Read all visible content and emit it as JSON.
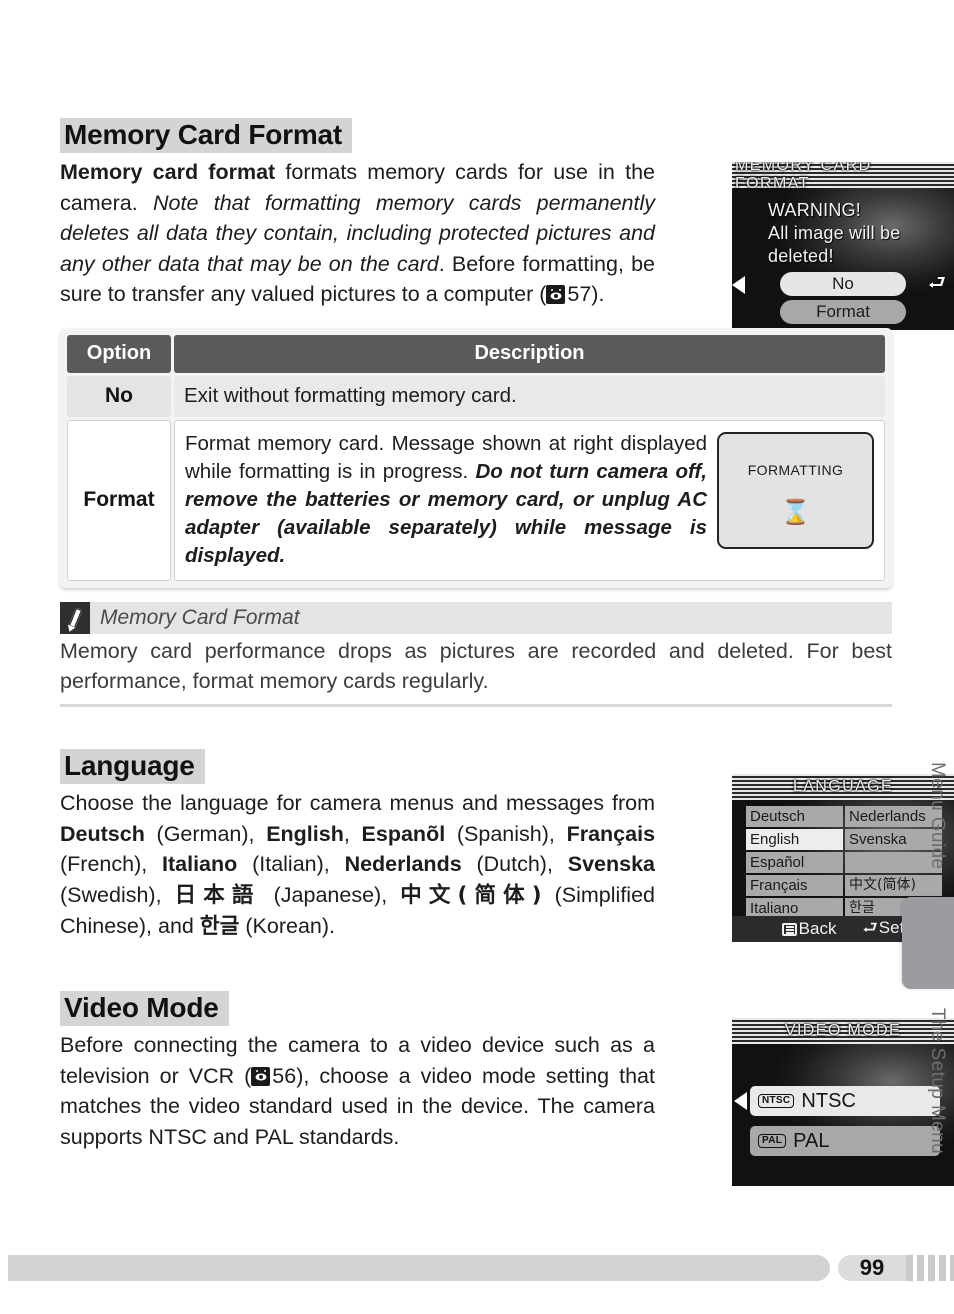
{
  "sections": {
    "memory_card_format": {
      "heading": "Memory Card Format",
      "body_parts": {
        "bold_lead": "Memory card format",
        "normal_1": " formats memory cards for use in the camera.  ",
        "italic_1": "Note that formatting memory cards permanently deletes all data they contain, including protected pictures and any other data that may be on the card",
        "normal_2": ".  Before formatting, be sure to transfer any valued pictures to a computer (",
        "page_ref": "57",
        "normal_3": ").",
        "ref_icon": "camera-eye-icon"
      },
      "lcd": {
        "title": "MEMORY CARD FORMAT",
        "warning_lines": [
          "WARNING!",
          "All image will be",
          "deleted!"
        ],
        "options": [
          {
            "label": "No",
            "selected": true
          },
          {
            "label": "Format",
            "selected": false
          }
        ],
        "left_arrow_icon": "arrow-left-icon",
        "enter_icon": "enter-return-icon"
      },
      "table": {
        "headers": [
          "Option",
          "Description"
        ],
        "rows": [
          {
            "option": "No",
            "description": "Exit without formatting memory card."
          },
          {
            "option": "Format",
            "description_normal": "Format memory card.  Message shown at right displayed while formatting is in progress.  ",
            "description_italic": "Do not turn camera off, remove the batteries or memory card, or unplug AC adapter (available separately) while message is displayed.",
            "inset": {
              "label": "FORMATTING",
              "icon": "hourglass-icon",
              "glyph": "⌛"
            }
          }
        ]
      },
      "note": {
        "icon": "pencil-icon",
        "title": "Memory Card Format",
        "body": "Memory card performance drops as pictures are recorded and deleted.  For best performance, format memory cards regularly."
      }
    },
    "language": {
      "heading": "Language",
      "body_parts": {
        "t1": "Choose the language for camera menus and messages from ",
        "b1": "Deutsch",
        "t2": " (German), ",
        "b2": "English",
        "t3": ", ",
        "b3": "Espanõl",
        "t4": " (Spanish), ",
        "b4": "Français",
        "t5": " (French), ",
        "b5": "Italiano",
        "t6": " (Italian), ",
        "b6": "Nederlands",
        "t7": " (Dutch), ",
        "b7": "Svenska",
        "t8": " (Swedish), ",
        "b8": "日本語",
        "t9": " (Japanese), ",
        "b9": "中文(简体)",
        "t10": " (Simplified Chinese), and ",
        "b10": "한글",
        "t11": " (Korean)."
      },
      "lcd": {
        "title": "LANGUAGE",
        "grid": [
          {
            "left": "Deutsch",
            "left_selected": false,
            "right": "Nederlands",
            "right_selected": false,
            "right_cjk": false
          },
          {
            "left": "English",
            "left_selected": true,
            "right": "Svenska",
            "right_selected": false,
            "right_cjk": false
          },
          {
            "left": "Español",
            "left_selected": false,
            "right": "",
            "right_selected": false,
            "right_cjk": false
          },
          {
            "left": "Français",
            "left_selected": false,
            "right": "中文(简体)",
            "right_selected": false,
            "right_cjk": true
          },
          {
            "left": "Italiano",
            "left_selected": false,
            "right": "한글",
            "right_selected": false,
            "right_cjk": true
          }
        ],
        "footer": {
          "back_label": "Back",
          "back_icon": "menu-list-icon",
          "set_label": "Set",
          "set_icon": "enter-return-icon",
          "set_glyph": "⮐"
        }
      }
    },
    "video_mode": {
      "heading": "Video Mode",
      "body_parts": {
        "t1": "Before connecting the camera to a video device such as a television or VCR (",
        "page_ref": "56",
        "t2": "), choose a video mode setting that matches the video standard used in the device.  The camera supports NTSC and PAL standards.",
        "ref_icon": "camera-eye-icon"
      },
      "lcd": {
        "title": "VIDEO MODE",
        "options": [
          {
            "badge": "NTSC",
            "label": "NTSC",
            "selected": true
          },
          {
            "badge": "PAL",
            "label": "PAL",
            "selected": false
          }
        ],
        "left_arrow_icon": "arrow-left-icon"
      }
    }
  },
  "side_tabs": {
    "top_label": "Menu Guide",
    "bottom_label": "The Setup Menu"
  },
  "footer": {
    "page_number": "99"
  },
  "colors": {
    "heading_highlight": "#d4d4d4",
    "table_header": "#5a5a5a",
    "tab_active": "#9a9ca0",
    "footer_bar": "#d2d3d5",
    "text": "#1d1d1d"
  }
}
